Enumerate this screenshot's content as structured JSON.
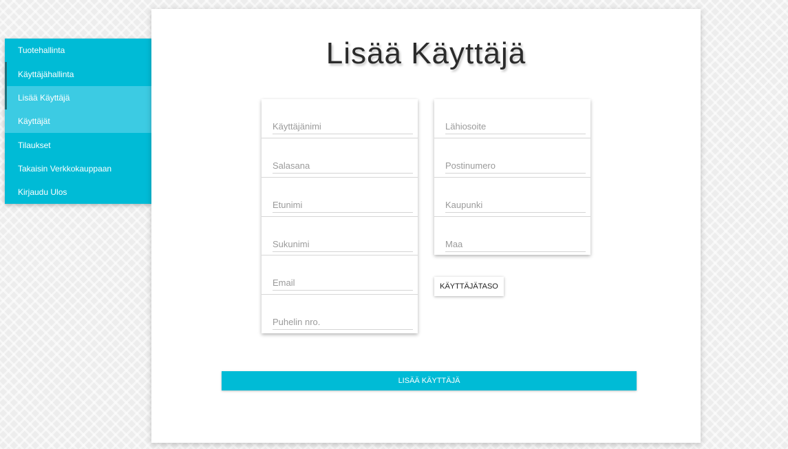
{
  "sidebar": {
    "items": [
      {
        "label": "Tuotehallinta"
      },
      {
        "label": "Käyttäjähallinta"
      },
      {
        "label": "Lisää Käyttäjä"
      },
      {
        "label": "Käyttäjät"
      },
      {
        "label": "Tilaukset"
      },
      {
        "label": "Takaisin Verkkokauppaan"
      },
      {
        "label": "Kirjaudu Ulos"
      }
    ],
    "accent_color": "#00bbd6",
    "sub_color": "#3ccbe3"
  },
  "main": {
    "title": "Lisää Käyttäjä",
    "left_fields": {
      "username": {
        "placeholder": "Käyttäjänimi",
        "value": ""
      },
      "password": {
        "placeholder": "Salasana",
        "value": ""
      },
      "firstname": {
        "placeholder": "Etunimi",
        "value": ""
      },
      "lastname": {
        "placeholder": "Sukunimi",
        "value": ""
      },
      "email": {
        "placeholder": "Email",
        "value": ""
      },
      "phone": {
        "placeholder": "Puhelin nro.",
        "value": ""
      }
    },
    "right_fields": {
      "address": {
        "placeholder": "Lähiosoite",
        "value": ""
      },
      "postal": {
        "placeholder": "Postinumero",
        "value": ""
      },
      "city": {
        "placeholder": "Kaupunki",
        "value": ""
      },
      "country": {
        "placeholder": "Maa",
        "value": ""
      }
    },
    "level_button": "KÄYTTÄJÄTASO",
    "submit_button": "LISÄÄ KÄYTTÄJÄ"
  }
}
